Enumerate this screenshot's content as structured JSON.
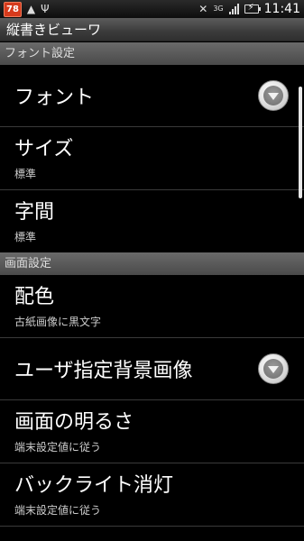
{
  "status_bar": {
    "notification_badge": "78",
    "time": "11:41",
    "network": "3G",
    "icons": [
      "warning-icon",
      "usb-icon",
      "mute-icon",
      "signal-icon",
      "battery-charging-icon"
    ]
  },
  "app": {
    "title": "縦書きビューワ"
  },
  "sections": {
    "font_settings": "フォント設定",
    "screen_settings": "画面設定"
  },
  "items": {
    "font": {
      "label": "フォント"
    },
    "size": {
      "label": "サイズ",
      "summary": "標準"
    },
    "spacing": {
      "label": "字間",
      "summary": "標準"
    },
    "color_scheme": {
      "label": "配色",
      "summary": "古紙画像に黒文字"
    },
    "user_bg": {
      "label": "ユーザ指定背景画像"
    },
    "brightness": {
      "label": "画面の明るさ",
      "summary": "端末設定値に従う"
    },
    "backlight_off": {
      "label": "バックライト消灯",
      "summary": "端末設定値に従う"
    }
  },
  "colors": {
    "badge": "#d63a1c",
    "section_header": "#5a5a5a",
    "background": "#000000"
  }
}
